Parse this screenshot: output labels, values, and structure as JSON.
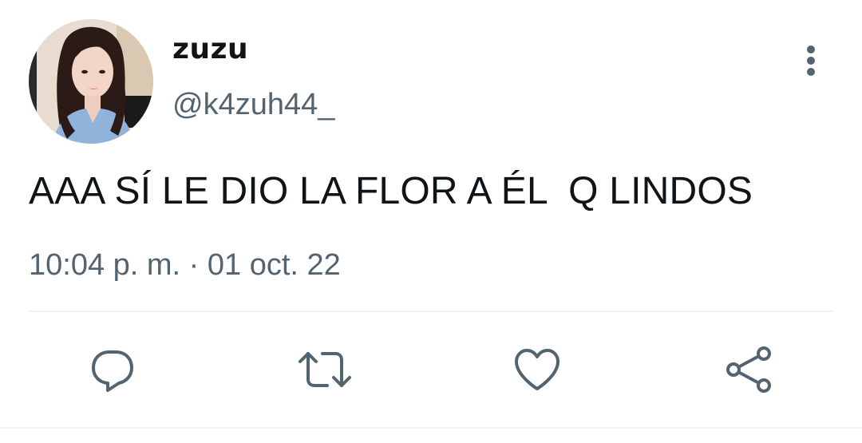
{
  "tweet": {
    "display_name": "zuzu",
    "handle": "@k4zuh44_",
    "text": "AAA SÍ LE DIO LA FLOR A ÉL  Q LINDOS",
    "timestamp": "10:04 p. m. · 01 oct. 22"
  },
  "icons": {
    "more": "vertical-ellipsis-icon",
    "reply": "speech-bubble-icon",
    "retweet": "retweet-arrows-icon",
    "like": "heart-icon",
    "share": "share-nodes-icon"
  },
  "colors": {
    "primary_text": "#0f1419",
    "secondary_text": "#536471",
    "icon": "#536471",
    "divider": "#eff3f4"
  }
}
